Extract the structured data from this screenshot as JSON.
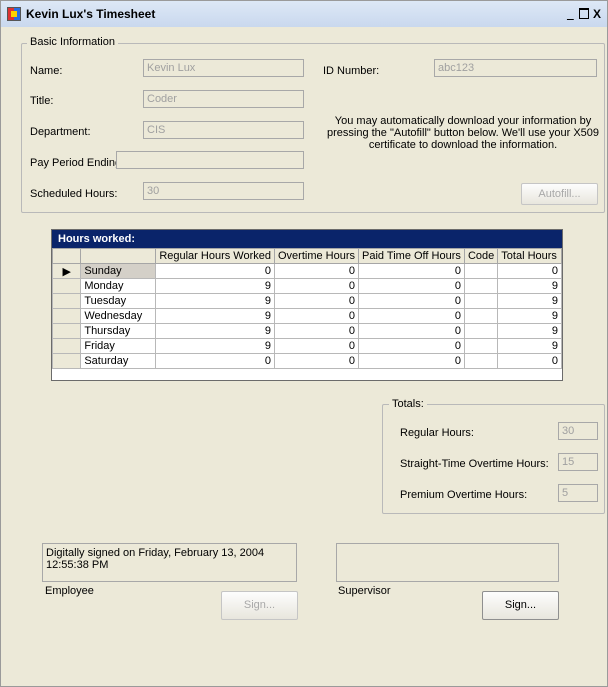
{
  "window": {
    "title": "Kevin Lux's Timesheet",
    "controls": {
      "minimize": "_",
      "close": "X"
    }
  },
  "basic_info": {
    "group_label": "Basic Information",
    "name_label": "Name:",
    "name_value": "Kevin Lux",
    "title_label": "Title:",
    "title_value": "Coder",
    "department_label": "Department:",
    "department_value": "CIS",
    "pay_period_label": "Pay Period Ending:",
    "pay_period_value": "",
    "scheduled_hours_label": "Scheduled Hours:",
    "scheduled_hours_value": "30",
    "id_label": "ID Number:",
    "id_value": "abc123",
    "autofill_note": "You may automatically download your information by pressing the \"Autofill\" button below. We'll use your X509 certificate to download the information.",
    "autofill_button": "Autofill..."
  },
  "hours_grid": {
    "caption": "Hours worked:",
    "columns": [
      "",
      "Regular Hours Worked",
      "Overtime Hours",
      "Paid Time Off Hours",
      "Code",
      "Total Hours"
    ],
    "current_row_marker": "▶",
    "rows": [
      {
        "day": "Sunday",
        "regular": "0",
        "overtime": "0",
        "pto": "0",
        "code": "",
        "total": "0"
      },
      {
        "day": "Monday",
        "regular": "9",
        "overtime": "0",
        "pto": "0",
        "code": "",
        "total": "9"
      },
      {
        "day": "Tuesday",
        "regular": "9",
        "overtime": "0",
        "pto": "0",
        "code": "",
        "total": "9"
      },
      {
        "day": "Wednesday",
        "regular": "9",
        "overtime": "0",
        "pto": "0",
        "code": "",
        "total": "9"
      },
      {
        "day": "Thursday",
        "regular": "9",
        "overtime": "0",
        "pto": "0",
        "code": "",
        "total": "9"
      },
      {
        "day": "Friday",
        "regular": "9",
        "overtime": "0",
        "pto": "0",
        "code": "",
        "total": "9"
      },
      {
        "day": "Saturday",
        "regular": "0",
        "overtime": "0",
        "pto": "0",
        "code": "",
        "total": "0"
      }
    ]
  },
  "totals": {
    "group_label": "Totals:",
    "regular_label": "Regular Hours:",
    "regular_value": "30",
    "straight_ot_label": "Straight-Time Overtime Hours:",
    "straight_ot_value": "15",
    "premium_ot_label": "Premium Overtime Hours:",
    "premium_ot_value": "5"
  },
  "signatures": {
    "employee_text": "Digitally signed on Friday, February 13, 2004 12:55:38 PM",
    "employee_label": "Employee",
    "employee_sign_button": "Sign...",
    "supervisor_text": "",
    "supervisor_label": "Supervisor",
    "supervisor_sign_button": "Sign..."
  }
}
